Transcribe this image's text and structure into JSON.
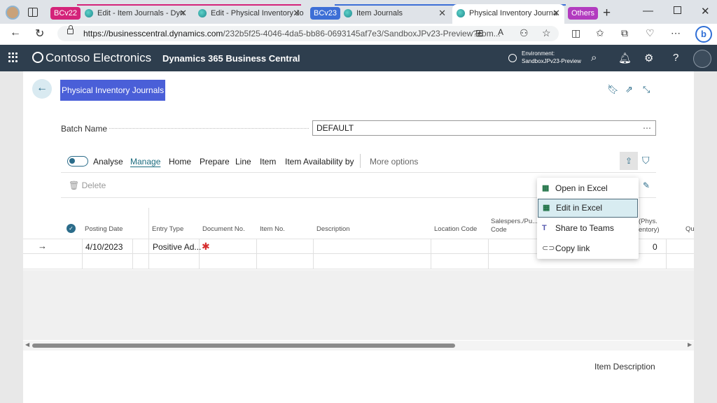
{
  "browser": {
    "tab_groups": [
      {
        "label": "BCv22",
        "color": "#d4237a"
      },
      {
        "label": "BCv23",
        "color": "#3d6fd6"
      },
      {
        "label": "Others",
        "color": "#b23bbf"
      }
    ],
    "tabs": [
      {
        "label": "Edit - Item Journals - Dyn"
      },
      {
        "label": "Edit - Physical Inventory Jo"
      },
      {
        "label": "Item Journals"
      },
      {
        "label": "Physical Inventory Journa"
      }
    ],
    "url_host": "https://businesscentral.dynamics.com",
    "url_path": "/232b5f25-4046-4da5-bb86-0693145af7e3/SandboxJPv23-Preview?com..."
  },
  "header": {
    "company": "Contoso Electronics",
    "product": "Dynamics 365 Business Central",
    "env_label": "Environment:",
    "env_name": "SandboxJPv23-Preview"
  },
  "page": {
    "title": "Physical Inventory Journals",
    "batch_label": "Batch Name",
    "batch_value": "DEFAULT",
    "batch_more": "⋯"
  },
  "actions": {
    "analyse": "Analyse",
    "items": [
      "Manage",
      "Home",
      "Prepare",
      "Line",
      "Item",
      "Item Availability by"
    ],
    "more": "More options",
    "delete": "Delete"
  },
  "grid": {
    "columns": {
      "posting_date": "Posting Date",
      "entry_type": "Entry Type",
      "document_no": "Document No.",
      "item_no": "Item No.",
      "description": "Description",
      "location_code": "Location Code",
      "salesperson_1": "Salespers./Pu...",
      "salesperson_2": "Code",
      "phys_1": "(Phys.",
      "phys_2": "entory)",
      "qu": "Qu"
    },
    "row": {
      "posting_date": "4/10/2023",
      "entry_type": "Positive Ad...",
      "required": "✱",
      "qty": "0"
    }
  },
  "menu": {
    "items": [
      "Open in Excel",
      "Edit in Excel",
      "Share to Teams",
      "Copy link"
    ],
    "highlighted": "Edit in Excel"
  },
  "footer": {
    "item_description": "Item Description"
  }
}
